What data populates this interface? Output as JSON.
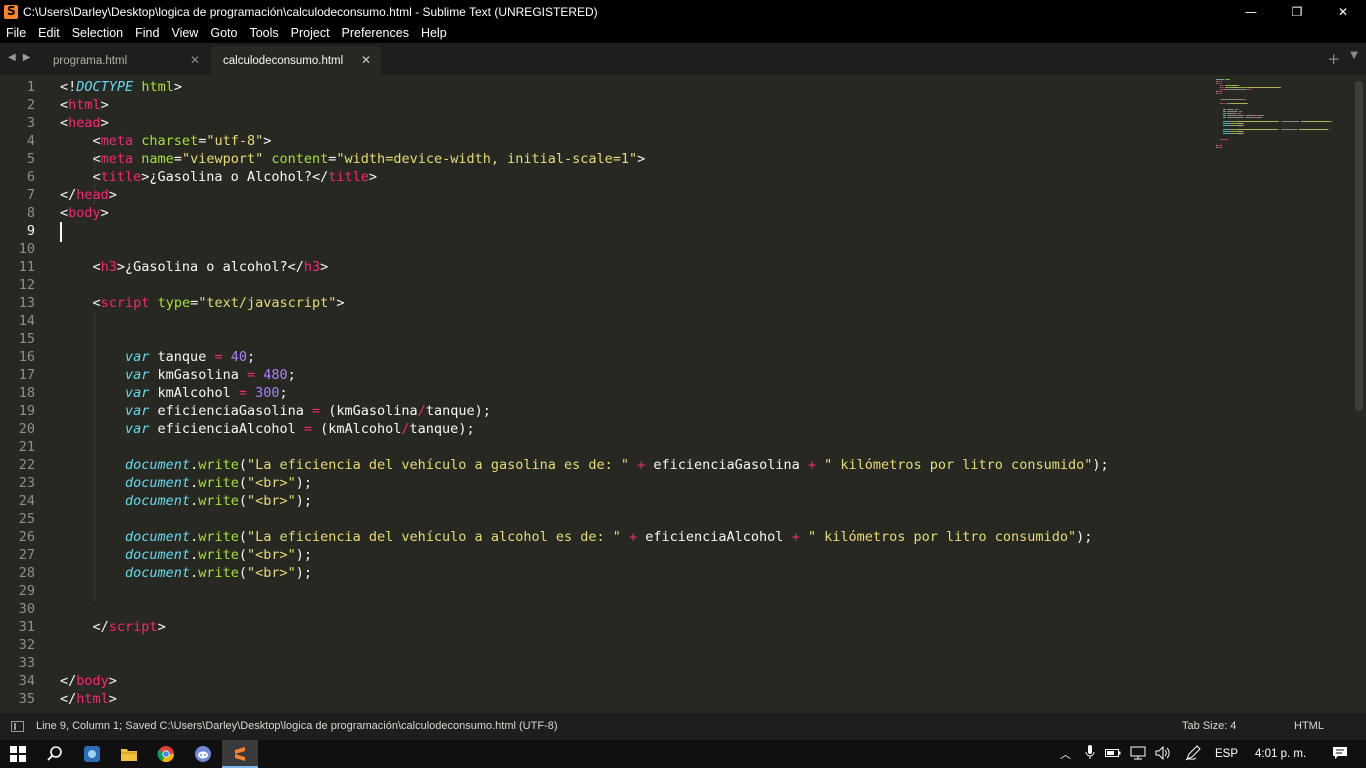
{
  "window": {
    "title": "C:\\Users\\Darley\\Desktop\\logica de programación\\calculodeconsumo.html - Sublime Text (UNREGISTERED)",
    "controls": {
      "minimize": "—",
      "restore": "❐",
      "close": "✕"
    }
  },
  "menu": [
    "File",
    "Edit",
    "Selection",
    "Find",
    "View",
    "Goto",
    "Tools",
    "Project",
    "Preferences",
    "Help"
  ],
  "tabs": [
    {
      "label": "programa.html",
      "active": false
    },
    {
      "label": "calculodeconsumo.html",
      "active": true
    }
  ],
  "editor": {
    "current_line": 9,
    "line_numbers": [
      "1",
      "2",
      "3",
      "4",
      "5",
      "6",
      "7",
      "8",
      "9",
      "10",
      "11",
      "12",
      "13",
      "14",
      "15",
      "16",
      "17",
      "18",
      "19",
      "20",
      "21",
      "22",
      "23",
      "24",
      "25",
      "26",
      "27",
      "28",
      "29",
      "30",
      "31",
      "32",
      "33",
      "34",
      "35"
    ],
    "code": [
      [
        [
          "p",
          "<!"
        ],
        [
          "k",
          "DOCTYPE"
        ],
        [
          "p",
          " "
        ],
        [
          "a",
          "html"
        ],
        [
          "p",
          ">"
        ]
      ],
      [
        [
          "p",
          "<"
        ],
        [
          "t",
          "html"
        ],
        [
          "p",
          ">"
        ]
      ],
      [
        [
          "p",
          "<"
        ],
        [
          "t",
          "head"
        ],
        [
          "p",
          ">"
        ]
      ],
      [
        [
          "p",
          "    <"
        ],
        [
          "t",
          "meta"
        ],
        [
          "p",
          " "
        ],
        [
          "a",
          "charset"
        ],
        [
          "p",
          "="
        ],
        [
          "s",
          "\"utf-8\""
        ],
        [
          "p",
          ">"
        ]
      ],
      [
        [
          "p",
          "    <"
        ],
        [
          "t",
          "meta"
        ],
        [
          "p",
          " "
        ],
        [
          "a",
          "name"
        ],
        [
          "p",
          "="
        ],
        [
          "s",
          "\"viewport\""
        ],
        [
          "p",
          " "
        ],
        [
          "a",
          "content"
        ],
        [
          "p",
          "="
        ],
        [
          "s",
          "\"width=device-width, initial-scale=1\""
        ],
        [
          "p",
          ">"
        ]
      ],
      [
        [
          "p",
          "    <"
        ],
        [
          "t",
          "title"
        ],
        [
          "p",
          ">¿Gasolina o Alcohol?</"
        ],
        [
          "t",
          "title"
        ],
        [
          "p",
          ">"
        ]
      ],
      [
        [
          "p",
          "</"
        ],
        [
          "t",
          "head"
        ],
        [
          "p",
          ">"
        ]
      ],
      [
        [
          "p",
          "<"
        ],
        [
          "t",
          "body"
        ],
        [
          "p",
          ">"
        ]
      ],
      [],
      [],
      [
        [
          "p",
          "    <"
        ],
        [
          "t",
          "h3"
        ],
        [
          "p",
          ">¿Gasolina o alcohol?</"
        ],
        [
          "t",
          "h3"
        ],
        [
          "p",
          ">"
        ]
      ],
      [],
      [
        [
          "p",
          "    <"
        ],
        [
          "t",
          "script"
        ],
        [
          "p",
          " "
        ],
        [
          "a",
          "type"
        ],
        [
          "p",
          "="
        ],
        [
          "s",
          "\"text/javascript\""
        ],
        [
          "p",
          ">"
        ]
      ],
      [],
      [],
      [
        [
          "p",
          "        "
        ],
        [
          "k",
          "var"
        ],
        [
          "p",
          " tanque "
        ],
        [
          "o",
          "="
        ],
        [
          "p",
          " "
        ],
        [
          "n",
          "40"
        ],
        [
          "p",
          ";"
        ]
      ],
      [
        [
          "p",
          "        "
        ],
        [
          "k",
          "var"
        ],
        [
          "p",
          " kmGasolina "
        ],
        [
          "o",
          "="
        ],
        [
          "p",
          " "
        ],
        [
          "n",
          "480"
        ],
        [
          "p",
          ";"
        ]
      ],
      [
        [
          "p",
          "        "
        ],
        [
          "k",
          "var"
        ],
        [
          "p",
          " kmAlcohol "
        ],
        [
          "o",
          "="
        ],
        [
          "p",
          " "
        ],
        [
          "n",
          "300"
        ],
        [
          "p",
          ";"
        ]
      ],
      [
        [
          "p",
          "        "
        ],
        [
          "k",
          "var"
        ],
        [
          "p",
          " eficienciaGasolina "
        ],
        [
          "o",
          "="
        ],
        [
          "p",
          " (kmGasolina"
        ],
        [
          "o",
          "/"
        ],
        [
          "p",
          "tanque);"
        ]
      ],
      [
        [
          "p",
          "        "
        ],
        [
          "k",
          "var"
        ],
        [
          "p",
          " eficienciaAlcohol "
        ],
        [
          "o",
          "="
        ],
        [
          "p",
          " (kmAlcohol"
        ],
        [
          "o",
          "/"
        ],
        [
          "p",
          "tanque);"
        ]
      ],
      [],
      [
        [
          "p",
          "        "
        ],
        [
          "d",
          "document"
        ],
        [
          "p",
          "."
        ],
        [
          "k2",
          "write"
        ],
        [
          "p",
          "("
        ],
        [
          "s",
          "\"La eficiencia del vehículo a gasolina es de: \""
        ],
        [
          "p",
          " "
        ],
        [
          "o",
          "+"
        ],
        [
          "p",
          " eficienciaGasolina "
        ],
        [
          "o",
          "+"
        ],
        [
          "p",
          " "
        ],
        [
          "s",
          "\" kilómetros por litro consumido\""
        ],
        [
          "p",
          ");"
        ]
      ],
      [
        [
          "p",
          "        "
        ],
        [
          "d",
          "document"
        ],
        [
          "p",
          "."
        ],
        [
          "k2",
          "write"
        ],
        [
          "p",
          "("
        ],
        [
          "s",
          "\"<br>\""
        ],
        [
          "p",
          ");"
        ]
      ],
      [
        [
          "p",
          "        "
        ],
        [
          "d",
          "document"
        ],
        [
          "p",
          "."
        ],
        [
          "k2",
          "write"
        ],
        [
          "p",
          "("
        ],
        [
          "s",
          "\"<br>\""
        ],
        [
          "p",
          ");"
        ]
      ],
      [],
      [
        [
          "p",
          "        "
        ],
        [
          "d",
          "document"
        ],
        [
          "p",
          "."
        ],
        [
          "k2",
          "write"
        ],
        [
          "p",
          "("
        ],
        [
          "s",
          "\"La eficiencia del vehículo a alcohol es de: \""
        ],
        [
          "p",
          " "
        ],
        [
          "o",
          "+"
        ],
        [
          "p",
          " eficienciaAlcohol "
        ],
        [
          "o",
          "+"
        ],
        [
          "p",
          " "
        ],
        [
          "s",
          "\" kilómetros por litro consumido\""
        ],
        [
          "p",
          ");"
        ]
      ],
      [
        [
          "p",
          "        "
        ],
        [
          "d",
          "document"
        ],
        [
          "p",
          "."
        ],
        [
          "k2",
          "write"
        ],
        [
          "p",
          "("
        ],
        [
          "s",
          "\"<br>\""
        ],
        [
          "p",
          ");"
        ]
      ],
      [
        [
          "p",
          "        "
        ],
        [
          "d",
          "document"
        ],
        [
          "p",
          "."
        ],
        [
          "k2",
          "write"
        ],
        [
          "p",
          "("
        ],
        [
          "s",
          "\"<br>\""
        ],
        [
          "p",
          ");"
        ]
      ],
      [],
      [],
      [
        [
          "p",
          "    </"
        ],
        [
          "t",
          "script"
        ],
        [
          "p",
          ">"
        ]
      ],
      [],
      [],
      [
        [
          "p",
          "</"
        ],
        [
          "t",
          "body"
        ],
        [
          "p",
          ">"
        ]
      ],
      [
        [
          "p",
          "</"
        ],
        [
          "t",
          "html"
        ],
        [
          "p",
          ">"
        ]
      ]
    ]
  },
  "status": {
    "text": "Line 9, Column 1; Saved C:\\Users\\Darley\\Desktop\\logica de programación\\calculodeconsumo.html (UTF-8)",
    "tab_size": "Tab Size: 4",
    "syntax": "HTML"
  },
  "taskbar": {
    "apps": [
      "windows-start-icon",
      "search-icon",
      "audio-app-icon",
      "file-explorer-icon",
      "chrome-icon",
      "discord-icon",
      "sublime-text-icon"
    ],
    "language": "ESP",
    "time": "4:01 p. m."
  },
  "colors": {
    "background": "#272822",
    "tag": "#f92672",
    "attribute": "#a6e22e",
    "string": "#e6db74",
    "keyword": "#66d9ef",
    "number": "#ae81ff"
  }
}
